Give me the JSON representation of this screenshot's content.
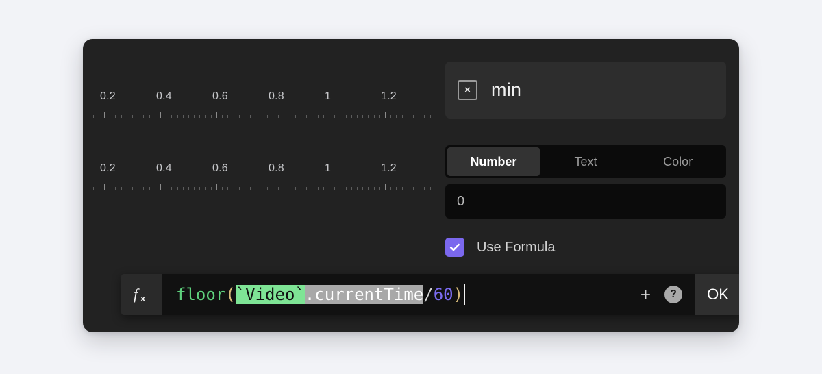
{
  "app": {
    "background_color": "#f2f3f7",
    "dialog_color": "#222222",
    "accent_color": "#7b68ee"
  },
  "left_pane": {
    "rulers": [
      {
        "labels": [
          "0.2",
          "0.4",
          "0.6",
          "0.8",
          "1",
          "1.2"
        ]
      },
      {
        "labels": [
          "0.2",
          "0.4",
          "0.6",
          "0.8",
          "1",
          "1.2"
        ]
      }
    ]
  },
  "properties": {
    "close_icon": "x-icon",
    "title": "min",
    "tabs": [
      {
        "label": "Number",
        "active": true
      },
      {
        "label": "Text",
        "active": false
      },
      {
        "label": "Color",
        "active": false
      }
    ],
    "value": "0",
    "value_placeholder": "0",
    "use_formula": {
      "label": "Use Formula",
      "checked": true,
      "color": "#7b68ee"
    }
  },
  "formula_bar": {
    "fx_icon": "function-icon",
    "tokens": [
      {
        "text": "floor",
        "kind": "function",
        "color": "#5ed17d"
      },
      {
        "text": "(",
        "kind": "paren",
        "color": "#d8bb7a"
      },
      {
        "text": "`Video`",
        "kind": "reference",
        "color": "#101010",
        "background": "#7ee495"
      },
      {
        "text": ".currentTime",
        "kind": "property",
        "color": "#ffffff",
        "background": "#a8a8a8"
      },
      {
        "text": "/",
        "kind": "operator",
        "color": "#d7d7d7"
      },
      {
        "text": "60",
        "kind": "number",
        "color": "#7b6cf0"
      },
      {
        "text": ")",
        "kind": "paren",
        "color": "#d8bb7a"
      }
    ],
    "full_text": "floor(`Video`.currentTime/60)",
    "add_label": "+",
    "help_label": "?",
    "ok_label": "OK"
  }
}
